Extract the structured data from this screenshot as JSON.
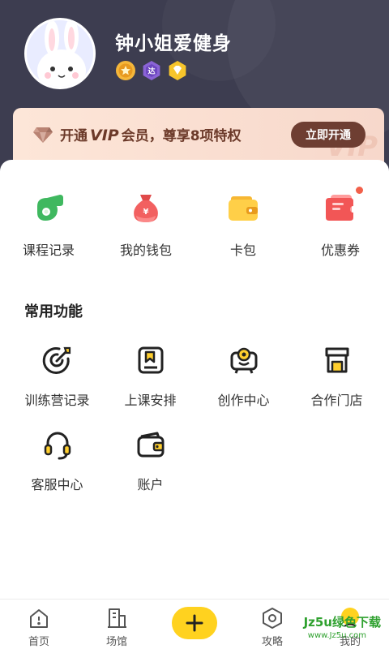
{
  "profile": {
    "username": "钟小姐爱健身",
    "badges": [
      "star-badge-icon",
      "level-badge-icon",
      "diamond-badge-icon"
    ]
  },
  "vip": {
    "text_prefix": "开通",
    "text_vip": "VIP",
    "text_suffix": "会员，尊享8项特权",
    "button_label": "立即开通",
    "bg_text": "VIP"
  },
  "quick_items": [
    {
      "label": "课程记录",
      "icon": "whistle-icon"
    },
    {
      "label": "我的钱包",
      "icon": "money-bag-icon"
    },
    {
      "label": "卡包",
      "icon": "wallet-icon"
    },
    {
      "label": "优惠券",
      "icon": "coupon-icon"
    }
  ],
  "common": {
    "title": "常用功能",
    "items": [
      {
        "label": "训练营记录",
        "icon": "target-icon"
      },
      {
        "label": "上课安排",
        "icon": "bookmark-schedule-icon"
      },
      {
        "label": "创作中心",
        "icon": "camera-icon"
      },
      {
        "label": "合作门店",
        "icon": "store-icon"
      },
      {
        "label": "客服中心",
        "icon": "headset-icon"
      },
      {
        "label": "账户",
        "icon": "account-wallet-icon"
      }
    ]
  },
  "nav": {
    "home": "首页",
    "venue": "场馆",
    "guide": "攻略",
    "mine": "我的"
  },
  "watermark": {
    "main": "Jz5u绿色下载",
    "sub": "www.Jz5u.com"
  },
  "colors": {
    "header_bg": "#3d3d50",
    "accent_yellow": "#ffd21f",
    "vip_brown": "#6e3e32",
    "icon_green": "#3fb85f",
    "badge_red": "#f2604a"
  }
}
